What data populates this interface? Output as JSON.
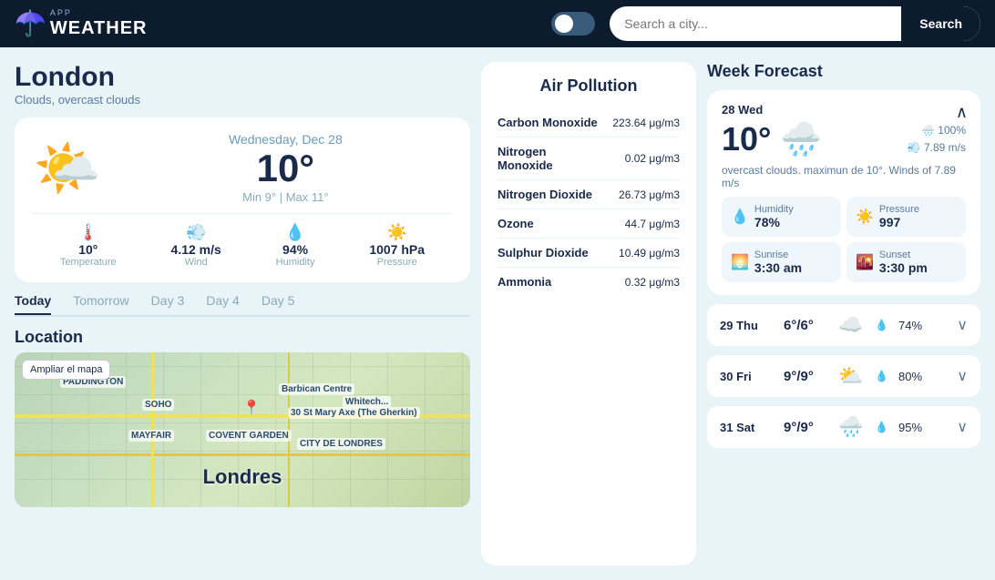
{
  "header": {
    "logo_app": "APP",
    "logo_weather": "WEATHER",
    "search_placeholder": "Search a city...",
    "search_button": "Search"
  },
  "city": {
    "name": "London",
    "description": "Clouds, overcast clouds"
  },
  "current_weather": {
    "date": "Wednesday, Dec 28",
    "temp": "10°",
    "min_max": "Min 9° | Max 11°",
    "temperature_value": "10°",
    "temperature_label": "Temperature",
    "wind_value": "4.12 m/s",
    "wind_label": "Wind",
    "humidity_value": "94%",
    "humidity_label": "Humidity",
    "pressure_value": "1007 hPa",
    "pressure_label": "Pressure"
  },
  "tabs": [
    {
      "label": "Today",
      "active": true
    },
    {
      "label": "Tomorrow",
      "active": false
    },
    {
      "label": "Day 3",
      "active": false
    },
    {
      "label": "Day 4",
      "active": false
    },
    {
      "label": "Day 5",
      "active": false
    }
  ],
  "location": {
    "title": "Location",
    "map_button": "Ampliar el mapa",
    "map_city_label": "Londres"
  },
  "air_pollution": {
    "title": "Air Pollution",
    "pollutants": [
      {
        "name": "Carbon Monoxide",
        "value": "223.64 μg/m3"
      },
      {
        "name": "Nitrogen Monoxide",
        "value": "0.02 μg/m3"
      },
      {
        "name": "Nitrogen Dioxide",
        "value": "26.73 μg/m3"
      },
      {
        "name": "Ozone",
        "value": "44.7 μg/m3"
      },
      {
        "name": "Sulphur Dioxide",
        "value": "10.49 μg/m3"
      },
      {
        "name": "Ammonia",
        "value": "0.32 μg/m3"
      }
    ]
  },
  "week_forecast": {
    "title": "Week Forecast",
    "main_day": {
      "date_label": "28 Wed",
      "temp": "10°",
      "rain_percent": "100%",
      "wind_speed": "7.89 m/s",
      "description": "overcast clouds. maximun de 10°. Winds of 7.89 m/s",
      "humidity_label": "Humidity",
      "humidity_value": "78%",
      "pressure_label": "Pressure",
      "pressure_value": "997",
      "sunrise_label": "Sunrise",
      "sunrise_value": "3:30 am",
      "sunset_label": "Sunset",
      "sunset_value": "3:30 pm"
    },
    "forecast_rows": [
      {
        "date": "29 Thu",
        "temp": "6°/6°",
        "icon": "☁️",
        "drop_icon": "💧",
        "percent": "74%"
      },
      {
        "date": "30 Fri",
        "temp": "9°/9°",
        "icon": "⛅",
        "drop_icon": "💧",
        "percent": "80%"
      },
      {
        "date": "31 Sat",
        "temp": "9°/9°",
        "icon": "🌧️",
        "drop_icon": "💧",
        "percent": "95%"
      }
    ]
  }
}
